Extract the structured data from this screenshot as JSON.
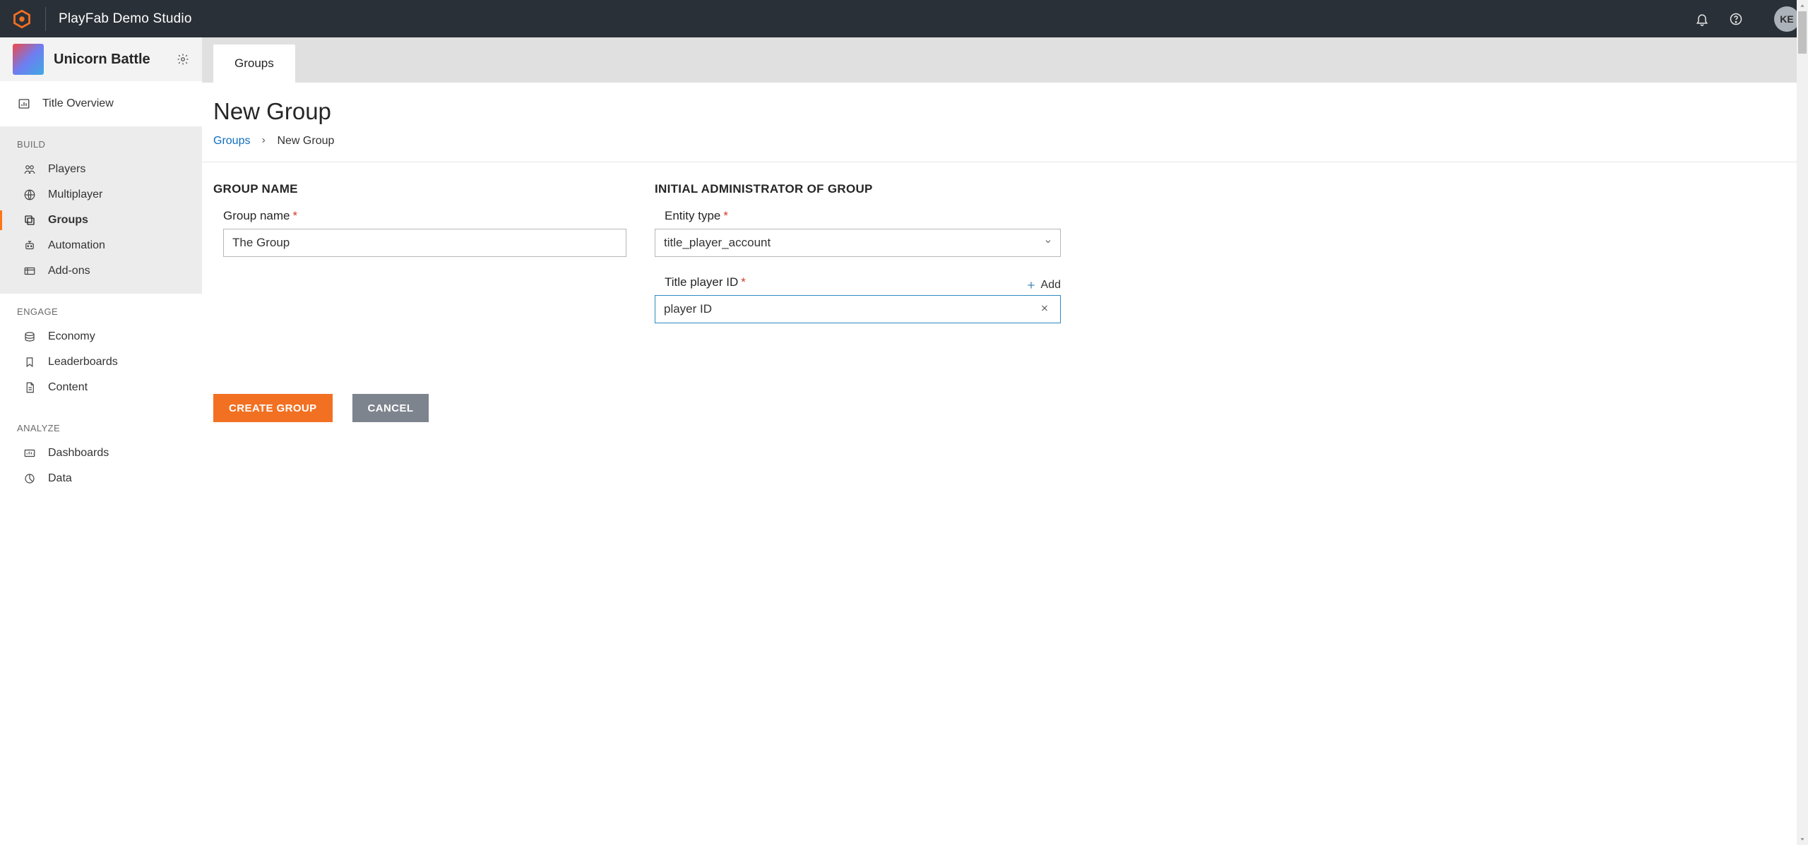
{
  "header": {
    "studio_name": "PlayFab Demo Studio",
    "avatar_initials": "KE"
  },
  "sidebar": {
    "title_name": "Unicorn Battle",
    "overview_label": "Title Overview",
    "sections": {
      "build": {
        "header": "BUILD",
        "items": [
          {
            "label": "Players"
          },
          {
            "label": "Multiplayer"
          },
          {
            "label": "Groups",
            "active": true
          },
          {
            "label": "Automation"
          },
          {
            "label": "Add-ons"
          }
        ]
      },
      "engage": {
        "header": "ENGAGE",
        "items": [
          {
            "label": "Economy"
          },
          {
            "label": "Leaderboards"
          },
          {
            "label": "Content"
          }
        ]
      },
      "analyze": {
        "header": "ANALYZE",
        "items": [
          {
            "label": "Dashboards"
          },
          {
            "label": "Data"
          }
        ]
      }
    }
  },
  "tabs": {
    "active_label": "Groups"
  },
  "page": {
    "title": "New Group",
    "breadcrumb_root": "Groups",
    "breadcrumb_current": "New Group"
  },
  "form": {
    "left_section_title": "GROUP NAME",
    "right_section_title": "INITIAL ADMINISTRATOR OF GROUP",
    "group_name": {
      "label": "Group name",
      "value": "The Group"
    },
    "entity_type": {
      "label": "Entity type",
      "value": "title_player_account"
    },
    "title_player_id": {
      "label": "Title player ID",
      "value": "player ID",
      "add_label": "Add"
    },
    "buttons": {
      "create": "CREATE GROUP",
      "cancel": "CANCEL"
    }
  }
}
